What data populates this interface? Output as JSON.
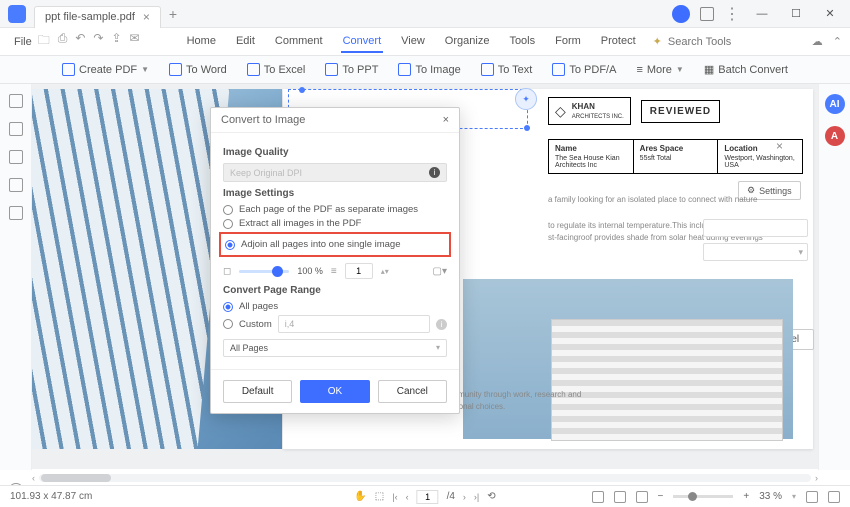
{
  "titlebar": {
    "tab_name": "ppt file-sample.pdf"
  },
  "menu": {
    "file": "File",
    "tabs": [
      "Home",
      "Edit",
      "Comment",
      "Convert",
      "View",
      "Organize",
      "Tools",
      "Form",
      "Protect"
    ],
    "active_tab": "Convert",
    "search_placeholder": "Search Tools"
  },
  "toolbar": {
    "create_pdf": "Create PDF",
    "to_word": "To Word",
    "to_excel": "To Excel",
    "to_ppt": "To PPT",
    "to_image": "To Image",
    "to_text": "To Text",
    "to_pdfa": "To PDF/A",
    "more": "More",
    "batch": "Batch Convert"
  },
  "doc": {
    "khan_name": "KHAN",
    "khan_sub": "ARCHITECTS INC.",
    "reviewed": "REVIEWED",
    "col1_h": "Name",
    "col1_v": "The Sea House Kian Architects Inc",
    "col2_h": "Ares Space",
    "col2_v": "55sft Total",
    "col3_h": "Location",
    "col3_v": "Westport, Washington, USA",
    "para1": "a family looking for an isolated place to connect with nature",
    "para2": "to regulate its internal temperature.This includes glazed areas",
    "para3": "st-facingroof provides shade from solar heat during evenings",
    "bottom": "community through work, research and personal choices.",
    "settings": "Settings",
    "cancel": "Cancel"
  },
  "modal": {
    "title": "Convert to Image",
    "sec_quality": "Image Quality",
    "dpi_placeholder": "Keep Original DPI",
    "sec_settings": "Image Settings",
    "opt_each": "Each page of the PDF as separate images",
    "opt_extract": "Extract all images in the PDF",
    "opt_adjoin": "Adjoin all pages into one single image",
    "zoom_val": "100 %",
    "page_count": "1",
    "sec_range": "Convert Page Range",
    "opt_allpages": "All pages",
    "opt_custom": "Custom",
    "custom_hint": "i,4",
    "select_pages": "All Pages",
    "btn_default": "Default",
    "btn_ok": "OK",
    "btn_cancel": "Cancel"
  },
  "status": {
    "coords": "101.93 x 47.87 cm",
    "page_current": "1",
    "page_total": "/4",
    "zoom": "33 %"
  }
}
